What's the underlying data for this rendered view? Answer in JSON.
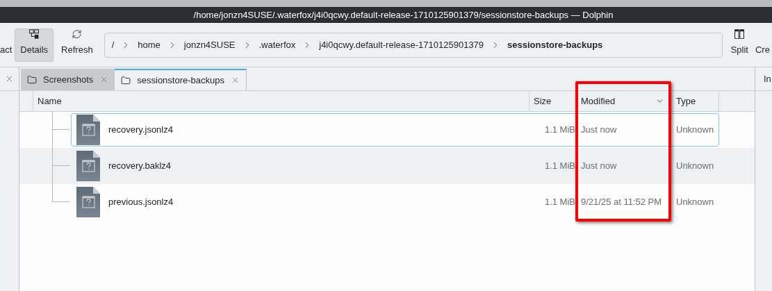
{
  "window": {
    "title": "/home/jonzn4SUSE/.waterfox/j4i0qcwy.default-release-1710125901379/sessionstore-backups — Dolphin"
  },
  "toolbar": {
    "buttons": [
      {
        "label": "act",
        "kind": "text",
        "selected": false
      },
      {
        "label": "Details",
        "kind": "details",
        "selected": true
      },
      {
        "label": "Refresh",
        "kind": "refresh",
        "selected": false
      }
    ],
    "breadcrumb": [
      {
        "label": "/",
        "current": false
      },
      {
        "label": "home",
        "current": false
      },
      {
        "label": "jonzn4SUSE",
        "current": false
      },
      {
        "label": ".waterfox",
        "current": false
      },
      {
        "label": "j4i0qcwy.default-release-1710125901379",
        "current": false
      },
      {
        "label": "sessionstore-backups",
        "current": true
      }
    ],
    "right_buttons": [
      {
        "label": "Split",
        "kind": "split"
      },
      {
        "label": "Cre",
        "kind": "text"
      }
    ]
  },
  "right_panel": {
    "title": "In"
  },
  "tabs": [
    {
      "label": "Screenshots",
      "selected": false
    },
    {
      "label": "sessionstore-backups",
      "selected": true
    }
  ],
  "table": {
    "columns": [
      {
        "label": "Name",
        "sorted": false
      },
      {
        "label": "Size",
        "sorted": false
      },
      {
        "label": "Modified",
        "sorted": true
      },
      {
        "label": "Type",
        "sorted": false
      }
    ],
    "rows": [
      {
        "name": "recovery.jsonlz4",
        "size": "1.1 MiB",
        "modified": "Just now",
        "type": "Unknown",
        "selected": true
      },
      {
        "name": "recovery.baklz4",
        "size": "1.1 MiB",
        "modified": "Just now",
        "type": "Unknown",
        "selected": false
      },
      {
        "name": "previous.jsonlz4",
        "size": "1.1 MiB",
        "modified": "9/21/25 at 11:52 PM",
        "type": "Unknown",
        "selected": false
      }
    ]
  }
}
